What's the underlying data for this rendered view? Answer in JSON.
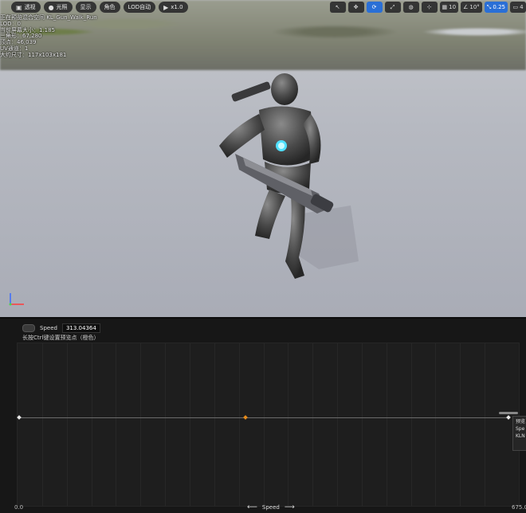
{
  "toolbar": {
    "items": [
      {
        "label": "透视",
        "icon": "cube-icon"
      },
      {
        "label": "光照",
        "icon": "sphere-icon"
      },
      {
        "label": "显示",
        "icon": ""
      },
      {
        "label": "角色",
        "icon": ""
      },
      {
        "label": "LOD自动",
        "icon": ""
      },
      {
        "label": "x1.0",
        "icon": "play-icon"
      }
    ],
    "right": {
      "grid_value": "10",
      "angle_value": "10°",
      "scale_value": "0.25",
      "camera_label": "4"
    }
  },
  "stats": {
    "line1": "正在预览混合空间 KL_Gun_Walk_Run",
    "line2": "LOD：0",
    "line3": "当前屏幕大小：1.185",
    "line4": "三角形：67,280",
    "line5": "顶点：46,039",
    "line6": "UV通道：1",
    "line7": "大约尺寸：117x103x181"
  },
  "panel": {
    "speed_label": "Speed",
    "speed_value": "313.04364",
    "hint": "长按Ctrl键设置预览点（橙色）",
    "axis_min": "0.0",
    "axis_max": "675.0",
    "axis_name": "Speed",
    "tooltip_lines": [
      "预览",
      "Spe",
      "KLN"
    ],
    "preview_point_fraction": 0.464
  },
  "colors": {
    "accent": "#2a6fd6",
    "preview_point": "#e68a1a"
  }
}
